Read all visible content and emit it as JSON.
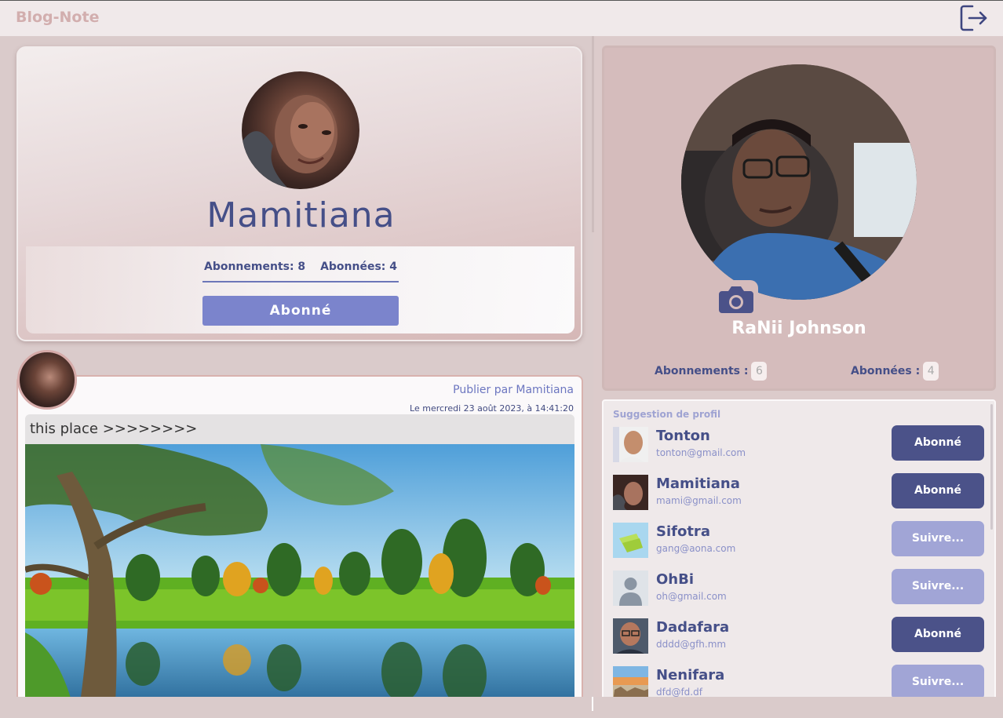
{
  "app": {
    "brand": "Blog-Note"
  },
  "profile": {
    "name": "Mamitiana",
    "subscriptions_label": "Abonnements: 8",
    "subscribers_label": "Abonnées: 4",
    "follow_button": "Abonné"
  },
  "post": {
    "author_line": "Publier par Mamitiana",
    "date_line": "Le mercredi 23 août 2023, à 14:41:20",
    "text": "this place >>>>>>>>"
  },
  "me": {
    "name": "RaNii Johnson",
    "subscriptions_label": "Abonnements :",
    "subscriptions_count": "6",
    "subscribers_label": "Abonnées :",
    "subscribers_count": "4"
  },
  "suggestions": {
    "title": "Suggestion de profil",
    "items": [
      {
        "name": "Tonton",
        "email": "tonton@gmail.com",
        "button": "Abonné",
        "followed": true
      },
      {
        "name": "Mamitiana",
        "email": "mami@gmail.com",
        "button": "Abonné",
        "followed": true
      },
      {
        "name": "Sifotra",
        "email": "gang@aona.com",
        "button": "Suivre...",
        "followed": false
      },
      {
        "name": "OhBi",
        "email": "oh@gmail.com",
        "button": "Suivre...",
        "followed": false
      },
      {
        "name": "Dadafara",
        "email": "dddd@gfh.mm",
        "button": "Abonné",
        "followed": true
      },
      {
        "name": "Nenifara",
        "email": "dfd@fd.df",
        "button": "Suivre...",
        "followed": false
      }
    ]
  },
  "colors": {
    "accent": "#7b84cc",
    "followed_button": "#4b5289",
    "follow_button": "#a1a5d6",
    "text_primary": "#454f88"
  },
  "icons": {
    "logout": "logout-icon",
    "camera": "camera-icon"
  }
}
